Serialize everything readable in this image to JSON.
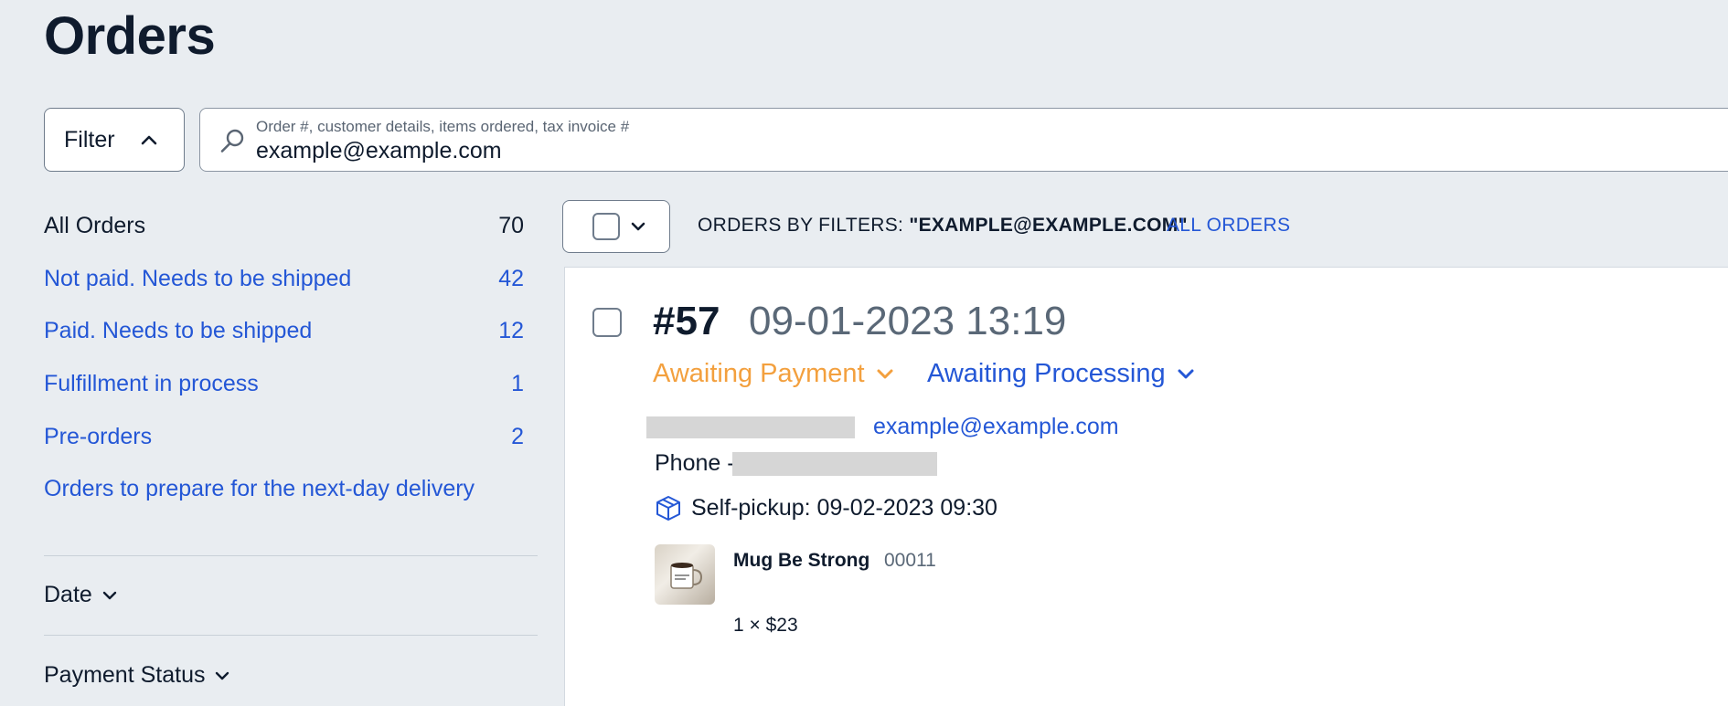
{
  "page": {
    "title": "Orders"
  },
  "filter": {
    "label": "Filter"
  },
  "search": {
    "label": "Order #, customer details, items ordered, tax invoice #",
    "value": "example@example.com"
  },
  "sidebar": {
    "categories": [
      {
        "label": "All Orders",
        "count": "70"
      },
      {
        "label": "Not paid. Needs to be shipped",
        "count": "42"
      },
      {
        "label": "Paid. Needs to be shipped",
        "count": "12"
      },
      {
        "label": "Fulfillment in process",
        "count": "1"
      },
      {
        "label": "Pre-orders",
        "count": "2"
      },
      {
        "label": "Orders to prepare for the next-day delivery",
        "count": ""
      }
    ],
    "sections": [
      {
        "label": "Date"
      },
      {
        "label": "Payment Status"
      }
    ]
  },
  "toolbar": {
    "filters_prefix": "ORDERS BY FILTERS: ",
    "filters_value": "\"EXAMPLE@EXAMPLE.COM\"",
    "all_orders_link": "ALL ORDERS"
  },
  "order": {
    "number": "#57",
    "datetime": "09-01-2023 13:19",
    "payment_status": "Awaiting Payment",
    "fulfillment_status": "Awaiting Processing",
    "email": "example@example.com",
    "phone_label": "Phone -",
    "pickup": "Self-pickup: 09-02-2023 09:30",
    "item": {
      "name": "Mug Be Strong",
      "sku": "00011",
      "qty_price": "1 × $23"
    }
  },
  "colors": {
    "accent_blue": "#2457d6",
    "payment_orange": "#f3a03e",
    "background": "#e9edf1"
  }
}
